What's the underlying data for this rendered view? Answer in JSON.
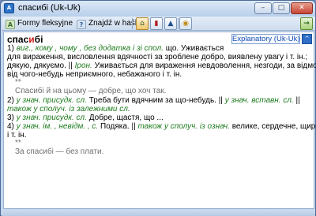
{
  "window": {
    "title": "спасибі (Uk-Uk)",
    "app_icon_text": "A",
    "min_icon": "–",
    "max_icon": "□",
    "close_icon": "✕"
  },
  "toolbar": {
    "forms_label": "Formy fleksyjne",
    "forms_icon": "A",
    "find_label": "Znajdź w haśle",
    "find_icon": "?",
    "home_icon": "⌂",
    "book_icon": "▮",
    "cap_icon": "▲",
    "settings_icon": "◉",
    "next_icon": "→"
  },
  "entry": {
    "headword_main": "спас",
    "headword_stressed": "и",
    "headword_end": "бі",
    "dictionary": "Explanatory (Uk-Uk)",
    "collapse_icon": "^"
  },
  "lines": {
    "l1_num": "1)",
    "l1_a": "виг.",
    "l1_b": ", кому , чому ,",
    "l1_c": "без додатка і зі",
    "l1_d": "спол.",
    "l1_e": " що. Уживається",
    "l2": "для вираження, висловлення вдячності за зроблене добро, виявлену увагу і т. ін.;",
    "l3_a": "дякую, дякуємо. ||",
    "l3_b": "Ірон.",
    "l3_c": " Уживається для вираження невдоволення, незгоди, за відмови",
    "l4": "від чого-небудь неприємного, небажаного і т. ін.",
    "l5": "**",
    "l6": "Спасибі й на цьому — добре, що хоч так.",
    "l7_num": "2)",
    "l7_a": "у знач.  присудк.  сл.",
    "l7_b": " Треба бути вдячним за що-небудь. ||",
    "l7_c": " у знач.  вставн.  сл.",
    "l7_d": " ||",
    "l8_a": "також",
    "l8_b": " у сполуч.  із залежними  сл.",
    "l9_num": "3)",
    "l9_a": "у знач.  присудк.  сл.",
    "l9_b": " Добре, щастя, що ...",
    "l10_num": "4)",
    "l10_a": "у знач.  ім. , невідм. , с.",
    "l10_b": " Подяка. ||",
    "l10_c": " також у сполуч.  із  означ.",
    "l10_d": " велике, сердечне, щире",
    "l11": "і т. ін.",
    "l12": "**",
    "l13": "За спасибі — без плати."
  }
}
